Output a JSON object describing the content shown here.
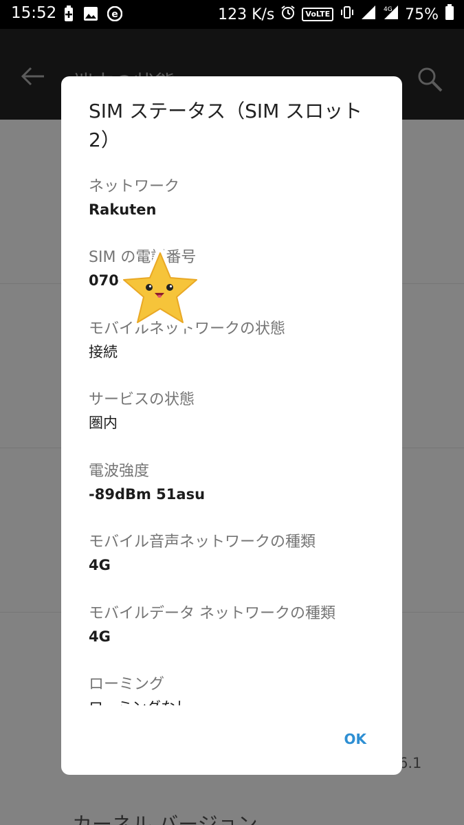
{
  "status_bar": {
    "time": "15:52",
    "left_icons": [
      "battery-saver-icon",
      "image-icon",
      "e-app-icon"
    ],
    "network_speed": "123 K/s",
    "volte": "VoLTE",
    "network_type": "4G",
    "battery": "75%"
  },
  "app_bar": {
    "title": "端末の状態",
    "back_icon": "back-arrow-icon",
    "search_icon": "search-icon"
  },
  "background": {
    "version_fragment": "6.1",
    "kernel_label": "カーネル バージョン"
  },
  "dialog": {
    "title": "SIM ステータス（SIM スロット 2）",
    "rows": [
      {
        "label": "ネットワーク",
        "value": "Rakuten"
      },
      {
        "label": "SIM の電話番号",
        "value": "070-"
      },
      {
        "label": "モバイルネットワークの状態",
        "value": "接続"
      },
      {
        "label": "サービスの状態",
        "value": "圏内"
      },
      {
        "label": "電波強度",
        "value": "-89dBm 51asu"
      },
      {
        "label": "モバイル音声ネットワークの種類",
        "value": "4G"
      },
      {
        "label": "モバイルデータ ネットワークの種類",
        "value": "4G"
      },
      {
        "label": "ローミング",
        "value": "ローミングなし"
      }
    ],
    "ok_label": "OK"
  },
  "colors": {
    "accent": "#2e8fd3",
    "scrim": "#8a8a8a",
    "dialog_bg": "#ffffff"
  }
}
